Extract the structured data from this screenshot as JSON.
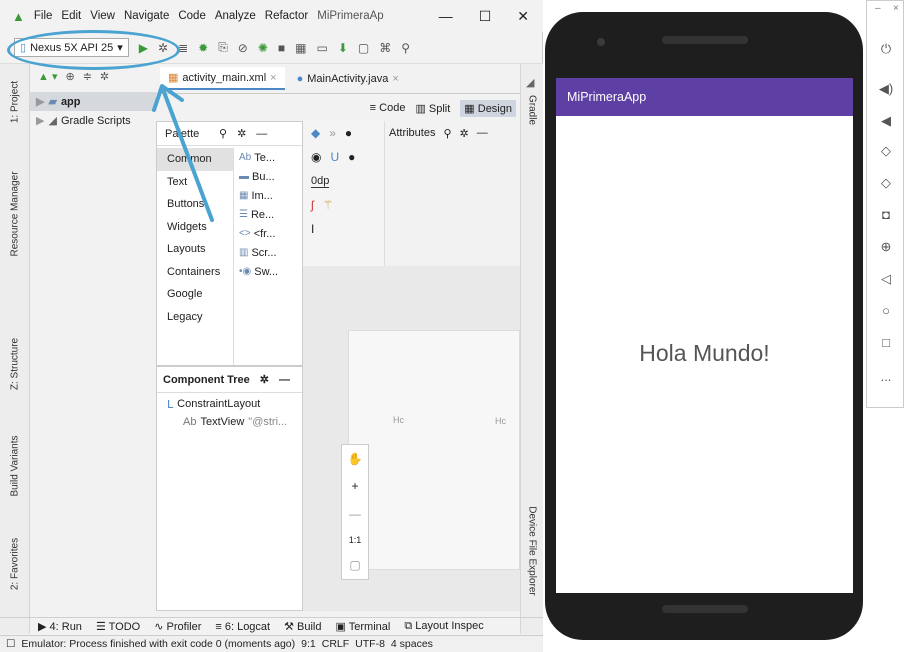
{
  "menubar": {
    "items": [
      "File",
      "Edit",
      "View",
      "Navigate",
      "Code",
      "Analyze",
      "Refactor",
      "MiPrimeraAp"
    ],
    "window_controls": [
      "—",
      "☐",
      "✕"
    ]
  },
  "toolbar": {
    "device_selector": "Nexus 5X API 25",
    "dropdown_arrow": "▾"
  },
  "sidebar_left": {
    "labels": [
      "1: Project",
      "Resource Manager",
      "Z: Structure",
      "Build Variants",
      "2: Favorites"
    ]
  },
  "project_panel": {
    "tree": [
      {
        "label": "app",
        "selected": true
      },
      {
        "label": "Gradle Scripts",
        "selected": false
      }
    ]
  },
  "editor_tabs": [
    {
      "label": "activity_main.xml",
      "active": true
    },
    {
      "label": "MainActivity.java",
      "active": false
    }
  ],
  "view_modes": {
    "code": "Code",
    "split": "Split",
    "design": "Design"
  },
  "palette": {
    "title": "Palette",
    "categories": [
      "Common",
      "Text",
      "Buttons",
      "Widgets",
      "Layouts",
      "Containers",
      "Google",
      "Legacy"
    ],
    "items": [
      {
        "icon": "Ab",
        "label": "Te..."
      },
      {
        "icon": "▬",
        "label": "Bu..."
      },
      {
        "icon": "▦",
        "label": "Im..."
      },
      {
        "icon": "☰",
        "label": "Re..."
      },
      {
        "icon": "<>",
        "label": "<fr..."
      },
      {
        "icon": "▥",
        "label": "Scr..."
      },
      {
        "icon": "•◉",
        "label": "Sw..."
      }
    ]
  },
  "design_tools": {
    "margin_value": "0dp"
  },
  "attributes": {
    "title": "Attributes"
  },
  "component_tree": {
    "title": "Component Tree",
    "nodes": [
      {
        "label": "ConstraintLayout",
        "icon": "Ⅼ",
        "detail": ""
      },
      {
        "label": "TextView",
        "icon": "Ab",
        "detail": "\"@stri..."
      }
    ]
  },
  "canvas": {
    "ghost_text_left": "Hc",
    "ghost_text_right": "Hc"
  },
  "zoom_controls": {
    "plus": "+",
    "minus": "—",
    "one_to_one": "1:1"
  },
  "sidebar_right": {
    "labels": [
      "Gradle",
      "Device File Explorer"
    ]
  },
  "bottom_tabs": [
    {
      "label": "4: Run"
    },
    {
      "label": "TODO"
    },
    {
      "label": "Profiler"
    },
    {
      "label": "6: Logcat"
    },
    {
      "label": "Build"
    },
    {
      "label": "Terminal"
    },
    {
      "label": "Layout Inspec"
    }
  ],
  "status_bar": {
    "message": "Emulator: Process finished with exit code 0 (moments ago)",
    "position": "9:1",
    "line_sep": "CRLF",
    "encoding": "UTF-8",
    "indent": "4 spaces"
  },
  "emulator": {
    "app_title": "MiPrimeraApp",
    "app_bar_color": "#5e3fa3",
    "content_text": "Hola Mundo!"
  },
  "emulator_panel": {
    "window_controls": [
      "–",
      "×"
    ],
    "more": "..."
  },
  "annotation": {
    "highlight_color": "#4aa3d0"
  }
}
